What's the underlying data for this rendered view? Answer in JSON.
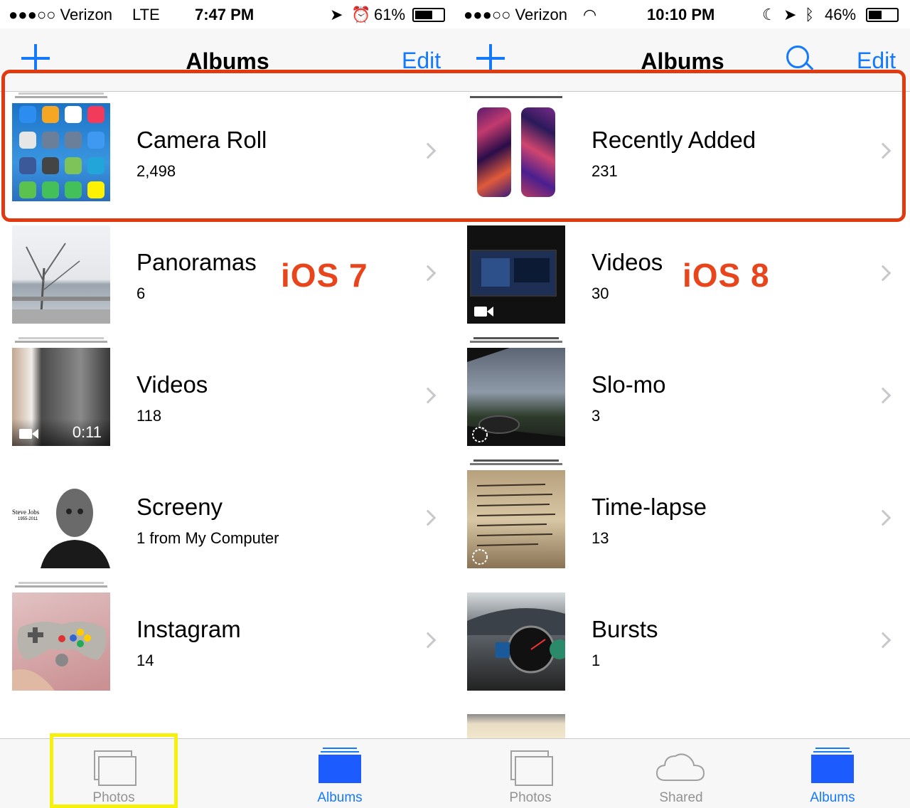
{
  "left": {
    "status": {
      "carrier": "●●●○○ Verizon",
      "network": "LTE",
      "time": "7:47 PM",
      "battery": "61%"
    },
    "nav": {
      "title": "Albums",
      "edit": "Edit"
    },
    "rows": [
      {
        "name": "Camera Roll",
        "count": "2,498"
      },
      {
        "name": "Panoramas",
        "count": "6"
      },
      {
        "name": "Videos",
        "count": "118",
        "duration": "0:11"
      },
      {
        "name": "Screeny",
        "count": "1 from My Computer",
        "thumb_caption": "Steve Jobs",
        "thumb_years": "1955-2011"
      },
      {
        "name": "Instagram",
        "count": "14"
      }
    ],
    "ios_label": "iOS 7",
    "tabs": {
      "photos": "Photos",
      "albums": "Albums"
    }
  },
  "right": {
    "status": {
      "carrier": "●●●○○ Verizon",
      "time": "10:10 PM",
      "battery": "46%"
    },
    "nav": {
      "title": "Albums",
      "edit": "Edit"
    },
    "rows": [
      {
        "name": "Recently Added",
        "count": "231"
      },
      {
        "name": "Videos",
        "count": "30"
      },
      {
        "name": "Slo-mo",
        "count": "3"
      },
      {
        "name": "Time-lapse",
        "count": "13"
      },
      {
        "name": "Bursts",
        "count": "1"
      }
    ],
    "ios_label": "iOS 8",
    "tabs": {
      "photos": "Photos",
      "shared": "Shared",
      "albums": "Albums"
    }
  },
  "colors": {
    "accent": "#1479fb",
    "annotation_red": "#e13a10",
    "annotation_yellow": "#f6f10a"
  }
}
